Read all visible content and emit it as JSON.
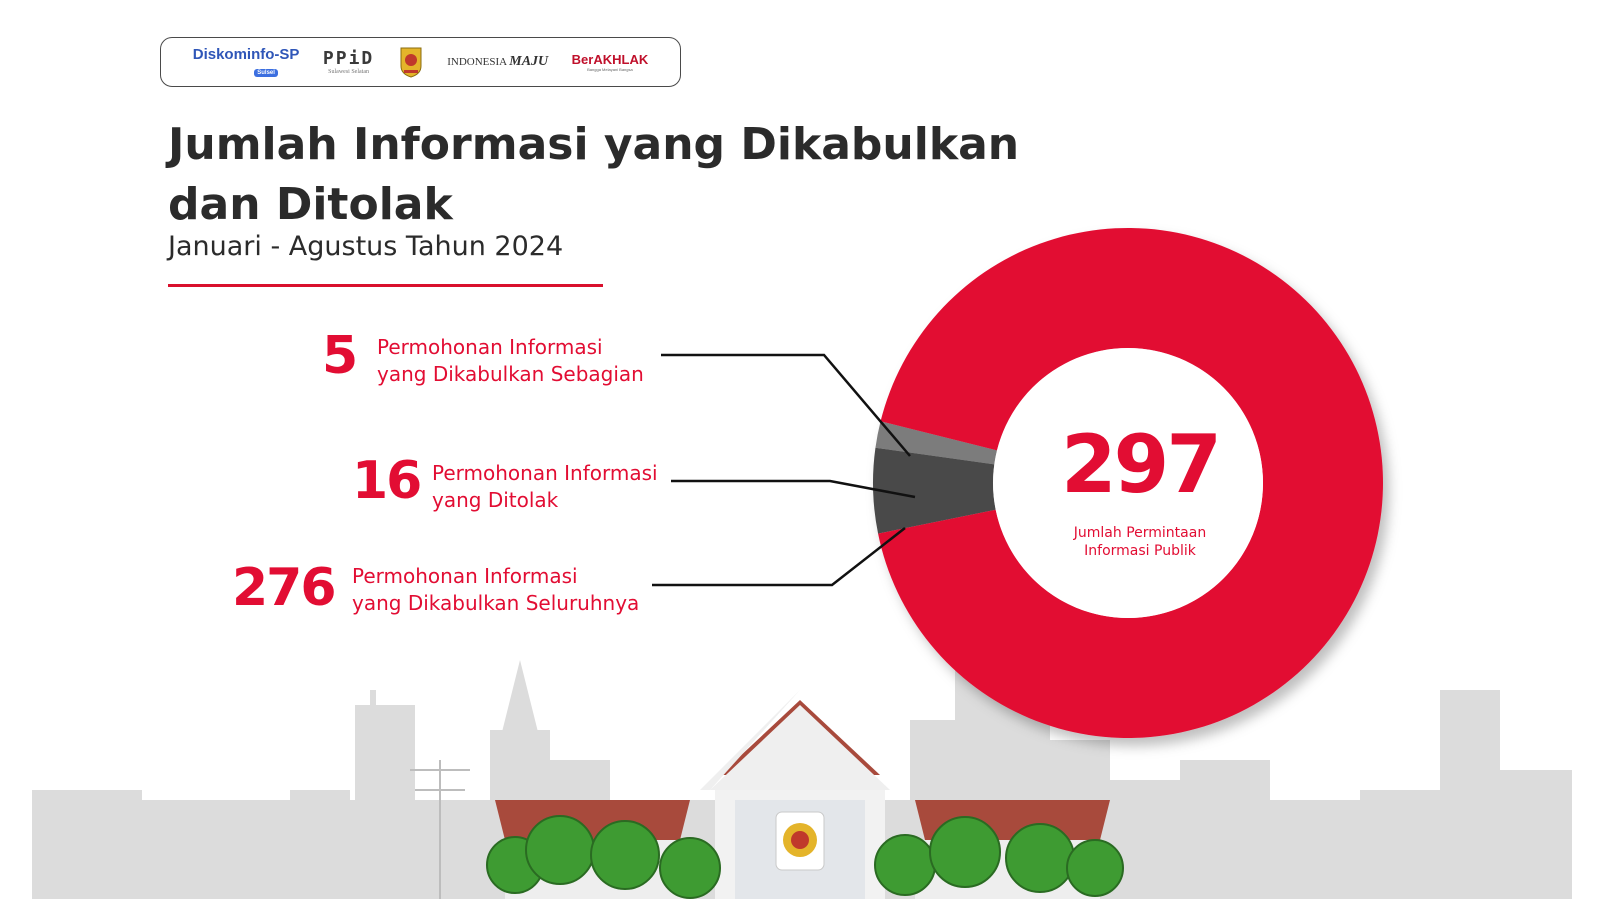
{
  "logos": {
    "diskominfo": "Diskominfo-SP",
    "diskominfo_sub": "Sulsel",
    "ppid": "PPiD",
    "ppid_sub": "Sulawesi Selatan",
    "indonesia": "INDONESIA",
    "maju": "MAJU",
    "berakhlak": "BerAKHLAK",
    "berakhlak_sub": "Bangga Melayani Bangsa"
  },
  "title_line1": "Jumlah Informasi yang Dikabulkan",
  "title_line2": "dan Ditolak",
  "subtitle": "Januari - Agustus Tahun 2024",
  "colors": {
    "accent": "#e20d33",
    "partial": "#7b7b7b",
    "rejected": "#4a4a4a",
    "text": "#2b2b2b",
    "skyline": "#d9d9d9"
  },
  "chart_data": {
    "type": "pie",
    "title": "Jumlah Informasi yang Dikabulkan dan Ditolak",
    "subtitle": "Januari - Agustus Tahun 2024",
    "total": 297,
    "total_label": "Jumlah Permintaan Informasi Publik",
    "slices": [
      {
        "label_line1": "Permohonan Informasi",
        "label_line2": "yang Dikabulkan Sebagian",
        "value": 5,
        "color": "#7b7b7b"
      },
      {
        "label_line1": "Permohonan Informasi",
        "label_line2": "yang Ditolak",
        "value": 16,
        "color": "#4a4a4a"
      },
      {
        "label_line1": "Permohonan Informasi",
        "label_line2": "yang Dikabulkan Seluruhnya",
        "value": 276,
        "color": "#e20d33"
      }
    ]
  },
  "total_label_line1": "Jumlah Permintaan",
  "total_label_line2": "Informasi Publik"
}
